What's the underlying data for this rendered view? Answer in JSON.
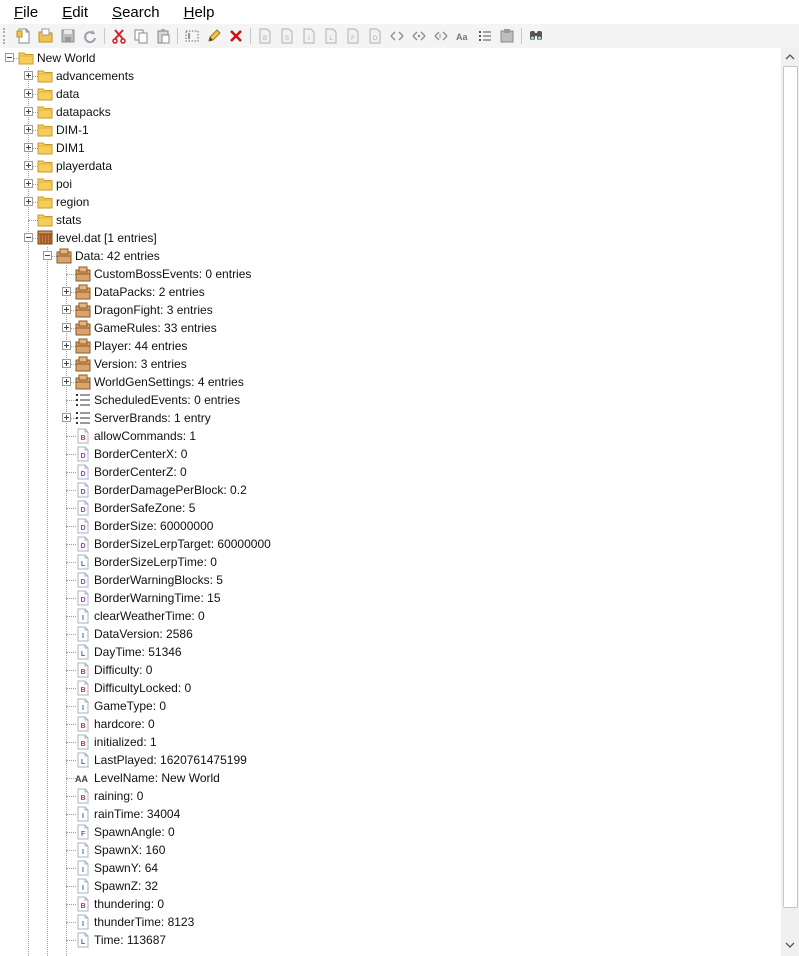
{
  "menu": [
    "File",
    "Edit",
    "Search",
    "Help"
  ],
  "toolbar": [
    {
      "name": "new-icon"
    },
    {
      "name": "open-folder-icon"
    },
    {
      "name": "save-icon"
    },
    {
      "name": "refresh-icon"
    },
    {
      "sep": true
    },
    {
      "name": "cut-icon"
    },
    {
      "name": "copy-icon"
    },
    {
      "name": "paste-icon"
    },
    {
      "sep": true
    },
    {
      "name": "rename-icon"
    },
    {
      "name": "edit-icon"
    },
    {
      "name": "delete-icon"
    },
    {
      "sep": true
    },
    {
      "name": "add-byte-icon"
    },
    {
      "name": "add-short-icon"
    },
    {
      "name": "add-int-icon"
    },
    {
      "name": "add-long-icon"
    },
    {
      "name": "add-float-icon"
    },
    {
      "name": "add-double-icon"
    },
    {
      "name": "add-byte-array-icon"
    },
    {
      "name": "add-int-array-icon"
    },
    {
      "name": "add-long-array-icon"
    },
    {
      "name": "add-string-icon"
    },
    {
      "name": "add-list-icon"
    },
    {
      "name": "add-compound-icon"
    },
    {
      "sep": true
    },
    {
      "name": "find-icon"
    }
  ],
  "tree": [
    {
      "depth": 0,
      "expander": "minus",
      "icon": "folder",
      "label": "New World"
    },
    {
      "depth": 1,
      "expander": "plus",
      "icon": "folder",
      "label": "advancements"
    },
    {
      "depth": 1,
      "expander": "plus",
      "icon": "folder",
      "label": "data"
    },
    {
      "depth": 1,
      "expander": "plus",
      "icon": "folder",
      "label": "datapacks"
    },
    {
      "depth": 1,
      "expander": "plus",
      "icon": "folder",
      "label": "DIM-1"
    },
    {
      "depth": 1,
      "expander": "plus",
      "icon": "folder",
      "label": "DIM1"
    },
    {
      "depth": 1,
      "expander": "plus",
      "icon": "folder",
      "label": "playerdata"
    },
    {
      "depth": 1,
      "expander": "plus",
      "icon": "folder",
      "label": "poi"
    },
    {
      "depth": 1,
      "expander": "plus",
      "icon": "folder",
      "label": "region"
    },
    {
      "depth": 1,
      "expander": "none",
      "icon": "folder",
      "label": "stats"
    },
    {
      "depth": 1,
      "expander": "minus",
      "icon": "file",
      "label": "level.dat [1 entries]"
    },
    {
      "depth": 2,
      "expander": "minus",
      "icon": "compound",
      "label": "Data: 42 entries"
    },
    {
      "depth": 3,
      "expander": "none",
      "icon": "compound",
      "label": "CustomBossEvents: 0 entries"
    },
    {
      "depth": 3,
      "expander": "plus",
      "icon": "compound",
      "label": "DataPacks: 2 entries"
    },
    {
      "depth": 3,
      "expander": "plus",
      "icon": "compound",
      "label": "DragonFight: 3 entries"
    },
    {
      "depth": 3,
      "expander": "plus",
      "icon": "compound",
      "label": "GameRules: 33 entries"
    },
    {
      "depth": 3,
      "expander": "plus",
      "icon": "compound",
      "label": "Player: 44 entries"
    },
    {
      "depth": 3,
      "expander": "plus",
      "icon": "compound",
      "label": "Version: 3 entries"
    },
    {
      "depth": 3,
      "expander": "plus",
      "icon": "compound",
      "label": "WorldGenSettings: 4 entries"
    },
    {
      "depth": 3,
      "expander": "none",
      "icon": "list",
      "label": "ScheduledEvents: 0 entries"
    },
    {
      "depth": 3,
      "expander": "plus",
      "icon": "list",
      "label": "ServerBrands: 1 entry"
    },
    {
      "depth": 3,
      "expander": "none",
      "icon": "tag",
      "tag": "B",
      "label": "allowCommands: 1"
    },
    {
      "depth": 3,
      "expander": "none",
      "icon": "tag",
      "tag": "D",
      "label": "BorderCenterX: 0"
    },
    {
      "depth": 3,
      "expander": "none",
      "icon": "tag",
      "tag": "D",
      "label": "BorderCenterZ: 0"
    },
    {
      "depth": 3,
      "expander": "none",
      "icon": "tag",
      "tag": "D",
      "label": "BorderDamagePerBlock: 0.2"
    },
    {
      "depth": 3,
      "expander": "none",
      "icon": "tag",
      "tag": "D",
      "label": "BorderSafeZone: 5"
    },
    {
      "depth": 3,
      "expander": "none",
      "icon": "tag",
      "tag": "D",
      "label": "BorderSize: 60000000"
    },
    {
      "depth": 3,
      "expander": "none",
      "icon": "tag",
      "tag": "D",
      "label": "BorderSizeLerpTarget: 60000000"
    },
    {
      "depth": 3,
      "expander": "none",
      "icon": "tag",
      "tag": "L",
      "label": "BorderSizeLerpTime: 0"
    },
    {
      "depth": 3,
      "expander": "none",
      "icon": "tag",
      "tag": "D",
      "label": "BorderWarningBlocks: 5"
    },
    {
      "depth": 3,
      "expander": "none",
      "icon": "tag",
      "tag": "D",
      "label": "BorderWarningTime: 15"
    },
    {
      "depth": 3,
      "expander": "none",
      "icon": "tag",
      "tag": "I",
      "label": "clearWeatherTime: 0"
    },
    {
      "depth": 3,
      "expander": "none",
      "icon": "tag",
      "tag": "I",
      "label": "DataVersion: 2586"
    },
    {
      "depth": 3,
      "expander": "none",
      "icon": "tag",
      "tag": "L",
      "label": "DayTime: 51346"
    },
    {
      "depth": 3,
      "expander": "none",
      "icon": "tag",
      "tag": "B",
      "label": "Difficulty: 0"
    },
    {
      "depth": 3,
      "expander": "none",
      "icon": "tag",
      "tag": "B",
      "label": "DifficultyLocked: 0"
    },
    {
      "depth": 3,
      "expander": "none",
      "icon": "tag",
      "tag": "I",
      "label": "GameType: 0"
    },
    {
      "depth": 3,
      "expander": "none",
      "icon": "tag",
      "tag": "B",
      "label": "hardcore: 0"
    },
    {
      "depth": 3,
      "expander": "none",
      "icon": "tag",
      "tag": "B",
      "label": "initialized: 1"
    },
    {
      "depth": 3,
      "expander": "none",
      "icon": "tag",
      "tag": "L",
      "label": "LastPlayed: 1620761475199"
    },
    {
      "depth": 3,
      "expander": "none",
      "icon": "string",
      "label": "LevelName: New World"
    },
    {
      "depth": 3,
      "expander": "none",
      "icon": "tag",
      "tag": "B",
      "label": "raining: 0"
    },
    {
      "depth": 3,
      "expander": "none",
      "icon": "tag",
      "tag": "I",
      "label": "rainTime: 34004"
    },
    {
      "depth": 3,
      "expander": "none",
      "icon": "tag",
      "tag": "F",
      "label": "SpawnAngle: 0"
    },
    {
      "depth": 3,
      "expander": "none",
      "icon": "tag",
      "tag": "I",
      "label": "SpawnX: 160"
    },
    {
      "depth": 3,
      "expander": "none",
      "icon": "tag",
      "tag": "I",
      "label": "SpawnY: 64"
    },
    {
      "depth": 3,
      "expander": "none",
      "icon": "tag",
      "tag": "I",
      "label": "SpawnZ: 32"
    },
    {
      "depth": 3,
      "expander": "none",
      "icon": "tag",
      "tag": "B",
      "label": "thundering: 0"
    },
    {
      "depth": 3,
      "expander": "none",
      "icon": "tag",
      "tag": "I",
      "label": "thunderTime: 8123"
    },
    {
      "depth": 3,
      "expander": "none",
      "icon": "tag",
      "tag": "L",
      "label": "Time: 113687"
    }
  ],
  "tag_colors": {
    "B": "#c0304a",
    "D": "#9a3ac0",
    "L": "#3a6ac0",
    "I": "#3a6ac0",
    "F": "#c03aa8"
  },
  "scrollbar": {
    "up": "scroll-up-icon",
    "down": "scroll-down-icon"
  }
}
